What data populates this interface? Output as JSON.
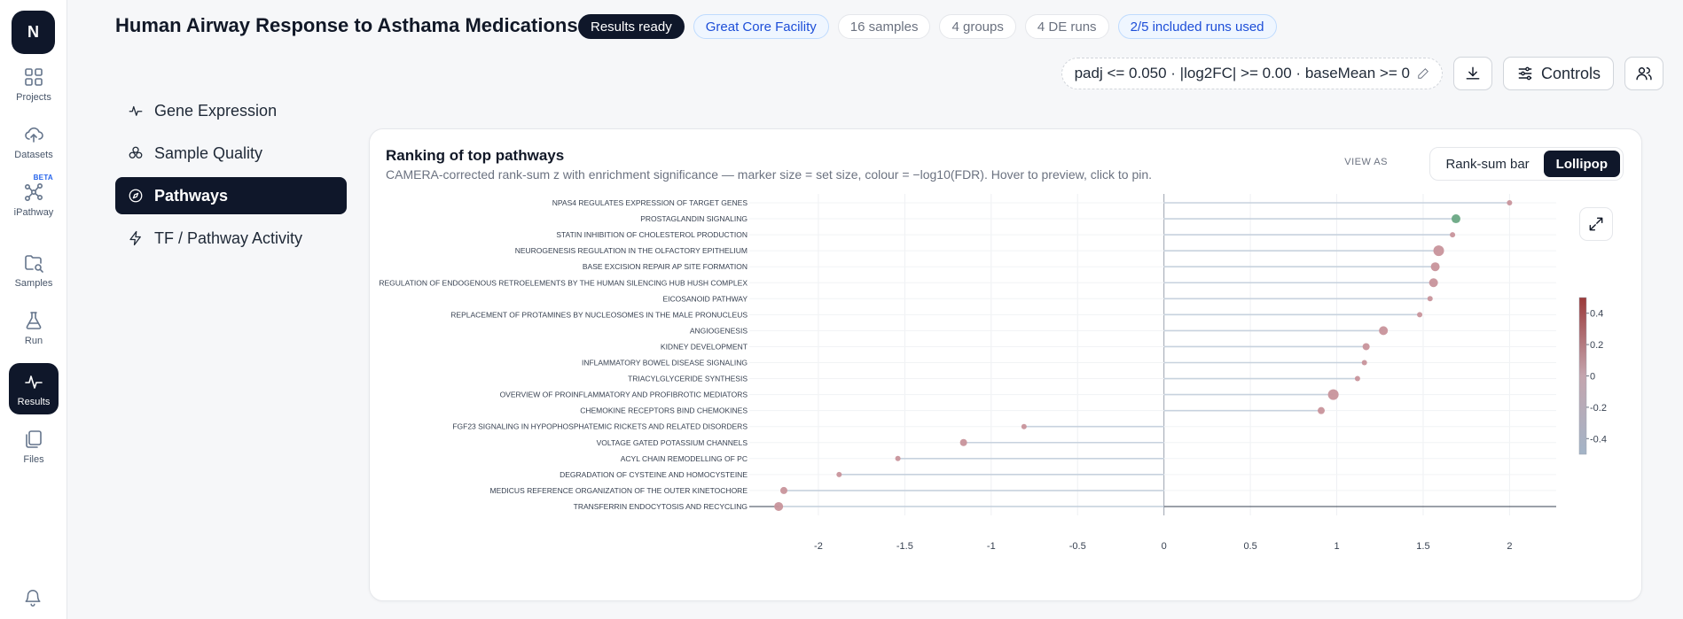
{
  "rail": {
    "logo": "N",
    "items": [
      {
        "label": "Projects",
        "icon": "grid-icon"
      },
      {
        "label": "Datasets",
        "icon": "cloud-upload-icon"
      },
      {
        "label": "iPathway",
        "icon": "network-icon",
        "badge": "BETA"
      },
      {
        "label": "Samples",
        "icon": "folder-search-icon"
      },
      {
        "label": "Run",
        "icon": "flask-icon"
      },
      {
        "label": "Results",
        "icon": "activity-icon",
        "active": true
      },
      {
        "label": "Files",
        "icon": "files-icon"
      }
    ],
    "bell_icon": "bell-icon"
  },
  "header": {
    "title": "Human Airway Response to Asthama Medications",
    "chips": [
      "Results ready",
      "Great Core Facility",
      "16 samples",
      "4 groups",
      "4 DE runs",
      "2/5 included runs used"
    ]
  },
  "toolbar": {
    "filter": "padj <= 0.050 · |log2FC| >= 0.00 · baseMean >= 0",
    "controls": "Controls"
  },
  "subnav": [
    {
      "label": "Gene Expression",
      "icon": "activity-icon"
    },
    {
      "label": "Sample Quality",
      "icon": "circles-icon"
    },
    {
      "label": "Pathways",
      "icon": "compass-icon",
      "active": true
    },
    {
      "label": "TF / Pathway Activity",
      "icon": "zap-icon"
    }
  ],
  "card": {
    "title": "Ranking of top pathways",
    "subtitle": "CAMERA-corrected rank-sum z with enrichment significance — marker size = set size, colour = −log10(FDR). Hover to preview, click to pin.",
    "view_as_label": "VIEW AS",
    "view_options": [
      "Rank-sum bar",
      "Lollipop"
    ],
    "active_view": "Lollipop"
  },
  "chart_data": {
    "type": "lollipop",
    "xlim": [
      -2.4,
      2.27
    ],
    "xticks": [
      -2,
      -1.5,
      -1,
      -0.5,
      0,
      0.5,
      1,
      1.5,
      2
    ],
    "xtick_labels": [
      "-2",
      "-1.5",
      "-1",
      "-0.5",
      "0",
      "0.5",
      "1",
      "1.5",
      "2"
    ],
    "colorbar": {
      "ticks": [
        0.4,
        0.2,
        0,
        -0.2,
        -0.4
      ],
      "range": [
        -0.5,
        0.5
      ],
      "colors": [
        "#a3b4c7",
        "#c4a5ae",
        "#9b3a3a"
      ]
    },
    "rows": [
      {
        "label": "NPAS4 REGULATES EXPRESSION OF TARGET GENES",
        "value": 2.0,
        "size": 3,
        "color": "#c8949b"
      },
      {
        "label": "PROSTAGLANDIN SIGNALING",
        "value": 1.69,
        "size": 5,
        "color": "#6aa884"
      },
      {
        "label": "STATIN INHIBITION OF CHOLESTEROL PRODUCTION",
        "value": 1.67,
        "size": 3,
        "color": "#c8949b"
      },
      {
        "label": "NEUROGENESIS REGULATION IN THE OLFACTORY EPITHELIUM",
        "value": 1.59,
        "size": 6,
        "color": "#c8949b"
      },
      {
        "label": "BASE EXCISION REPAIR AP SITE FORMATION",
        "value": 1.57,
        "size": 5,
        "color": "#c8949b"
      },
      {
        "label": "REGULATION OF ENDOGENOUS RETROELEMENTS BY THE HUMAN SILENCING HUB HUSH COMPLEX",
        "value": 1.56,
        "size": 5,
        "color": "#c8949b"
      },
      {
        "label": "EICOSANOID PATHWAY",
        "value": 1.54,
        "size": 3,
        "color": "#c8949b"
      },
      {
        "label": "REPLACEMENT OF PROTAMINES BY NUCLEOSOMES IN THE MALE PRONUCLEUS",
        "value": 1.48,
        "size": 3,
        "color": "#c8949b"
      },
      {
        "label": "ANGIOGENESIS",
        "value": 1.27,
        "size": 5,
        "color": "#c8949b"
      },
      {
        "label": "KIDNEY DEVELOPMENT",
        "value": 1.17,
        "size": 4,
        "color": "#c8949b"
      },
      {
        "label": "INFLAMMATORY BOWEL DISEASE SIGNALING",
        "value": 1.16,
        "size": 3,
        "color": "#c8949b"
      },
      {
        "label": "TRIACYLGLYCERIDE SYNTHESIS",
        "value": 1.12,
        "size": 3,
        "color": "#c8949b"
      },
      {
        "label": "OVERVIEW OF PROINFLAMMATORY AND PROFIBROTIC MEDIATORS",
        "value": 0.98,
        "size": 6,
        "color": "#c8949b"
      },
      {
        "label": "CHEMOKINE RECEPTORS BIND CHEMOKINES",
        "value": 0.91,
        "size": 4,
        "color": "#c8949b"
      },
      {
        "label": "FGF23 SIGNALING IN HYPOPHOSPHATEMIC RICKETS AND RELATED DISORDERS",
        "value": -0.81,
        "size": 3,
        "color": "#c8949b"
      },
      {
        "label": "VOLTAGE GATED POTASSIUM CHANNELS",
        "value": -1.16,
        "size": 4,
        "color": "#c8949b"
      },
      {
        "label": "ACYL CHAIN REMODELLING OF PC",
        "value": -1.54,
        "size": 3,
        "color": "#c8949b"
      },
      {
        "label": "DEGRADATION OF CYSTEINE AND HOMOCYSTEINE",
        "value": -1.88,
        "size": 3,
        "color": "#c8949b"
      },
      {
        "label": "MEDICUS REFERENCE ORGANIZATION OF THE OUTER KINETOCHORE",
        "value": -2.2,
        "size": 4,
        "color": "#c8949b"
      },
      {
        "label": "TRANSFERRIN ENDOCYTOSIS AND RECYCLING",
        "value": -2.23,
        "size": 5,
        "color": "#c8949b"
      }
    ]
  }
}
